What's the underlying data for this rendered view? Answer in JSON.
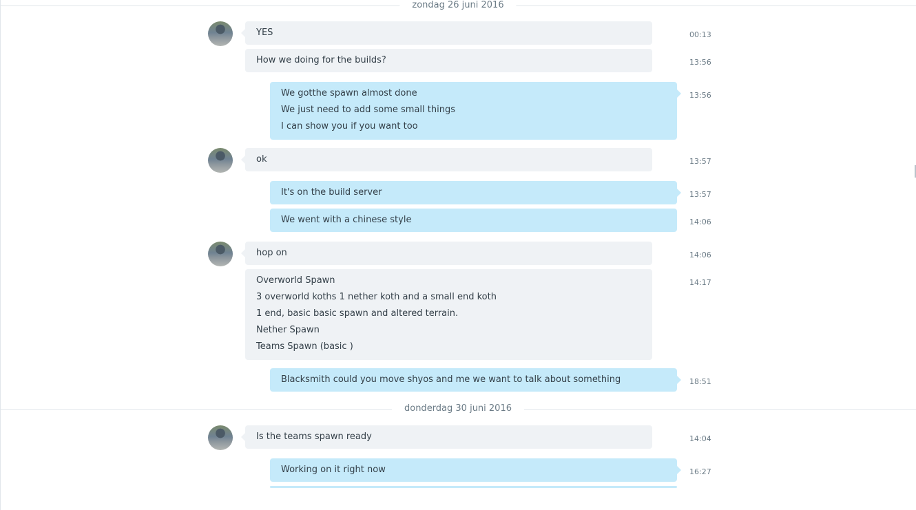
{
  "date_separators": [
    {
      "label": "zondag 26 juni 2016"
    },
    {
      "label": "donderdag 30 juni 2016"
    }
  ],
  "messages": [
    {
      "direction": "in",
      "time": "00:13",
      "lines": [
        "YES"
      ]
    },
    {
      "direction": "in",
      "time": "13:56",
      "lines": [
        "How we doing for the builds?"
      ]
    },
    {
      "direction": "out",
      "time": "13:56",
      "lines": [
        "We gotthe spawn almost done",
        "We just need to add some small things",
        "I can show you if you want too"
      ]
    },
    {
      "direction": "in",
      "time": "13:57",
      "lines": [
        "ok"
      ]
    },
    {
      "direction": "out",
      "time": "13:57",
      "lines": [
        "It's on the build server"
      ]
    },
    {
      "direction": "out",
      "time": "14:06",
      "lines": [
        "We went with a chinese style"
      ]
    },
    {
      "direction": "in",
      "time": "14:06",
      "lines": [
        "hop on"
      ]
    },
    {
      "direction": "in",
      "time": "14:17",
      "lines": [
        "Overworld Spawn",
        "3 overworld koths 1 nether koth and a small end koth",
        "1 end, basic basic spawn and altered terrain.",
        "Nether Spawn",
        "Teams Spawn (basic )"
      ]
    },
    {
      "direction": "out",
      "time": "18:51",
      "lines": [
        "Blacksmith could you move shyos and me we want to talk about something"
      ]
    },
    {
      "direction": "in",
      "time": "14:04",
      "lines": [
        "Is the teams spawn ready"
      ]
    },
    {
      "direction": "out",
      "time": "16:27",
      "lines": [
        "Working on it right now"
      ]
    }
  ],
  "colors": {
    "incoming_bubble": "#eff2f5",
    "outgoing_bubble": "#c5eafa",
    "text": "#333f48",
    "meta_text": "#6b7b86"
  }
}
